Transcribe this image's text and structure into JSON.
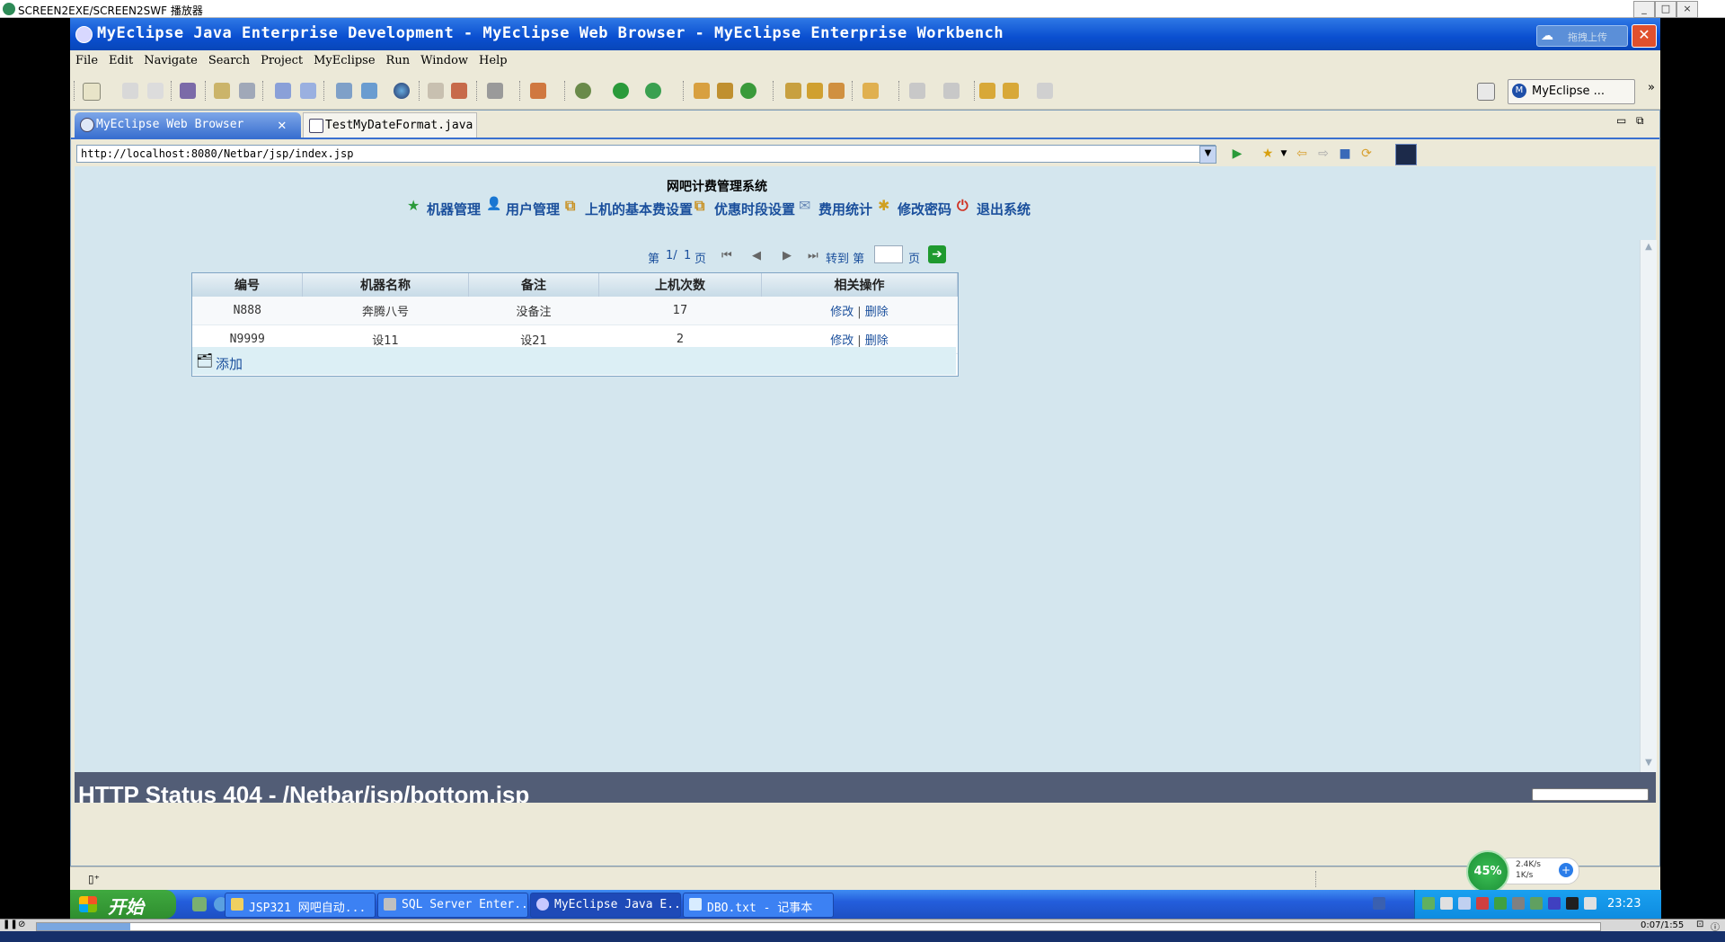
{
  "player": {
    "title": "SCREEN2EXE/SCREEN2SWF 播放器",
    "time": "0:07/1:55",
    "progress_fraction": 0.06
  },
  "window": {
    "title": "MyEclipse Java Enterprise Development - MyEclipse Web Browser - MyEclipse Enterprise Workbench",
    "upload_label": "拖拽上传",
    "close_label": "✕"
  },
  "menu": [
    "File",
    "Edit",
    "Navigate",
    "Search",
    "Project",
    "MyEclipse",
    "Run",
    "Window",
    "Help"
  ],
  "perspective": {
    "label": "MyEclipse ...",
    "icon": "M"
  },
  "tabs": [
    {
      "label": "MyEclipse Web Browser",
      "icon": "globe-icon",
      "active": true
    },
    {
      "label": "TestMyDateFormat.java",
      "icon": "java-file-icon",
      "active": false
    }
  ],
  "browser": {
    "url": "http://localhost:8080/Netbar/jsp/index.jsp"
  },
  "app": {
    "title": "网吧计费管理系统",
    "nav": [
      {
        "label": "机器管理",
        "icon": "★"
      },
      {
        "label": "用户管理",
        "icon": "👤"
      },
      {
        "label": "上机的基本费设置",
        "icon": "⧉"
      },
      {
        "label": "优惠时段设置",
        "icon": "⧉"
      },
      {
        "label": "费用统计",
        "icon": "✉"
      },
      {
        "label": "修改密码",
        "icon": "✱"
      },
      {
        "label": "退出系统",
        "icon": "⏻"
      }
    ],
    "pager": {
      "prefix": "第",
      "current": "1/",
      "total": "1",
      "suffix": "页",
      "goto_prefix": "转到 第",
      "goto_suffix": "页"
    },
    "table": {
      "headers": [
        "编号",
        "机器名称",
        "备注",
        "上机次数",
        "相关操作"
      ],
      "rows": [
        {
          "id": "N888",
          "name": "奔腾八号",
          "note": "没备注",
          "count": "17"
        },
        {
          "id": "N9999",
          "name": "设11",
          "note": "设21",
          "count": "2"
        }
      ],
      "edit_label": "修改",
      "separator": "|",
      "delete_label": "删除",
      "add_label": "添加"
    }
  },
  "status_bar": {
    "error_text": "HTTP Status 404 - /Netbar/jsp/bottom.jsp"
  },
  "net": {
    "percent": "45%",
    "up": "2.4K/s",
    "down": "1K/s"
  },
  "taskbar": {
    "start_label": "开始",
    "tasks": [
      {
        "label": "JSP321 网吧自动...",
        "active": false
      },
      {
        "label": "SQL Server Enter...",
        "active": false
      },
      {
        "label": "MyEclipse Java E...",
        "active": true
      },
      {
        "label": "DBO.txt - 记事本",
        "active": false
      }
    ],
    "clock": "23:23"
  }
}
